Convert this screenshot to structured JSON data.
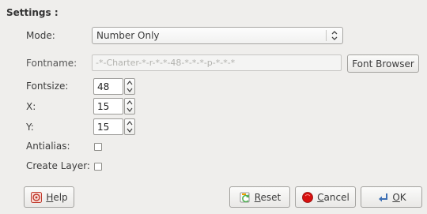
{
  "settings": {
    "title": "Settings :",
    "mode": {
      "label": "Mode:",
      "value": "Number Only"
    },
    "fontname": {
      "label": "Fontname:",
      "value": "-*-Charter-*-r-*-*-48-*-*-*-p-*-*-*",
      "browse_label": "Font Browser"
    },
    "fontsize": {
      "label": "Fontsize:",
      "value": "48"
    },
    "x": {
      "label": "X:",
      "value": "15"
    },
    "y": {
      "label": "Y:",
      "value": "15"
    },
    "antialias": {
      "label": "Antialias:",
      "checked": false
    },
    "create_layer": {
      "label": "Create Layer:",
      "checked": false
    }
  },
  "buttons": {
    "help": {
      "mnemonic": "H",
      "rest": "elp",
      "icon": "help-icon"
    },
    "reset": {
      "mnemonic": "R",
      "rest": "eset",
      "icon": "reset-icon"
    },
    "cancel": {
      "mnemonic": "C",
      "rest": "ancel",
      "icon": "cancel-icon"
    },
    "ok": {
      "mnemonic": "O",
      "rest": "K",
      "icon": "ok-icon"
    }
  },
  "colors": {
    "background": "#efeeec",
    "cancel_red": "#d6110f"
  }
}
